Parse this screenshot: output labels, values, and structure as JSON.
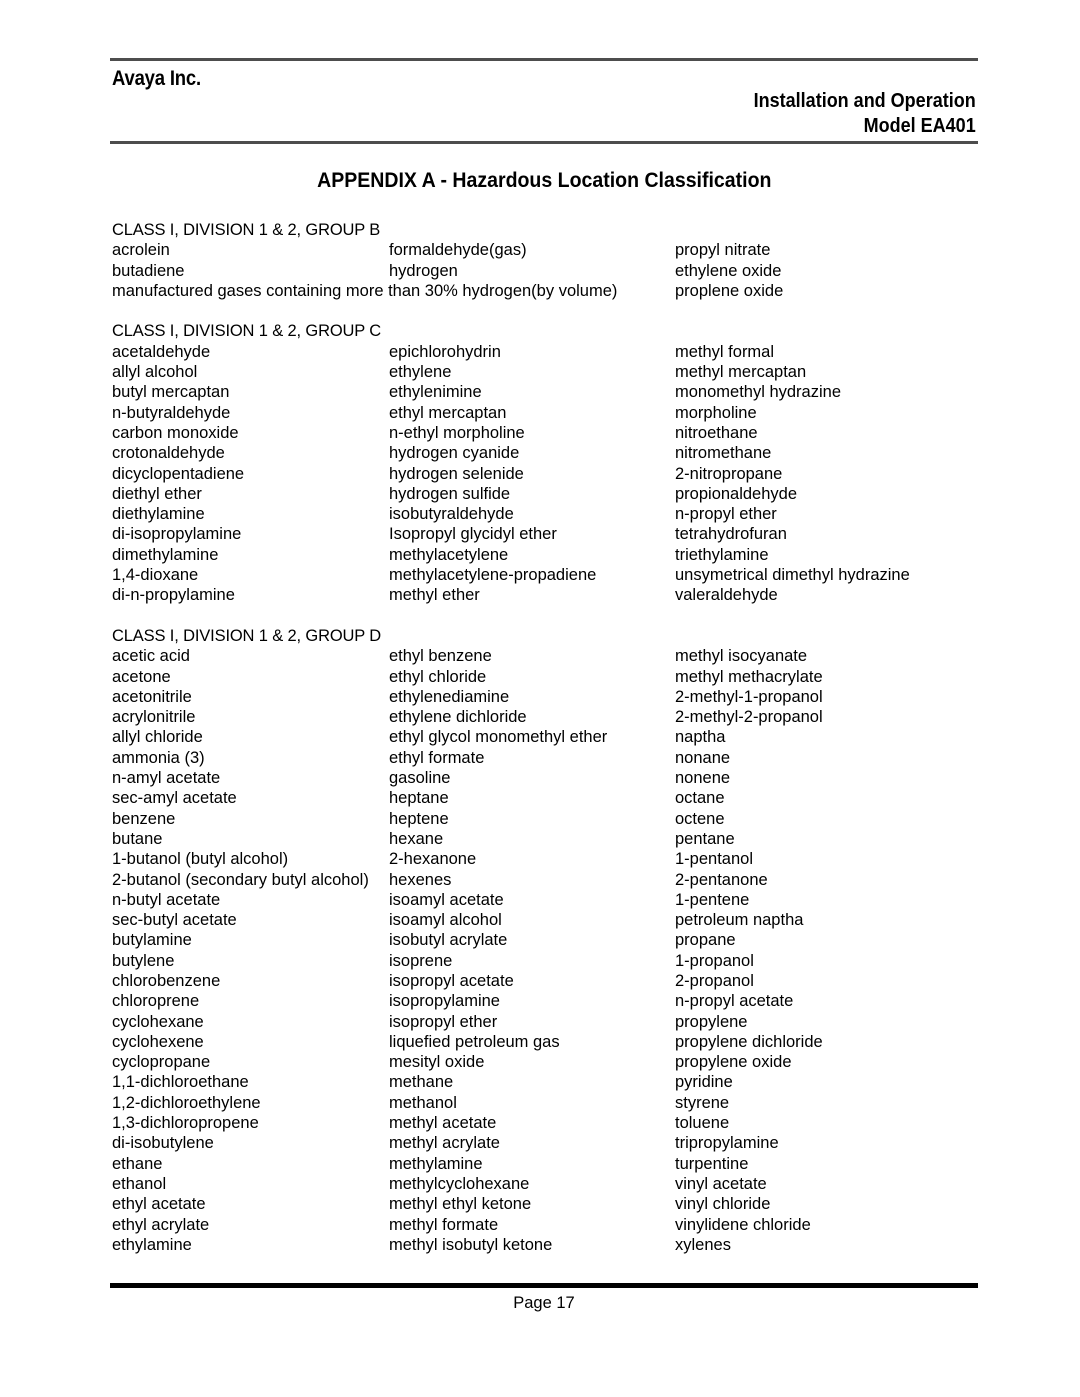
{
  "header": {
    "company": "Avaya Inc.",
    "doc_line1": "Installation and Operation",
    "doc_line2": "Model EA401"
  },
  "title": "APPENDIX A - Hazardous Location Classification",
  "footer": {
    "page_label": "Page 17"
  },
  "groups": [
    {
      "heading": "CLASS I, DIVISION 1 & 2, GROUP B",
      "rows": [
        {
          "c1": "acrolein",
          "c2": "formaldehyde(gas)",
          "c3": "propyl nitrate"
        },
        {
          "c1": "butadiene",
          "c2": "hydrogen",
          "c3": "ethylene oxide"
        },
        {
          "c1": "manufactured gases containing more than 30% hydrogen(by volume)",
          "c2": "",
          "c3": "proplene oxide"
        }
      ]
    },
    {
      "heading": "CLASS I, DIVISION 1 & 2, GROUP C",
      "rows": [
        {
          "c1": "acetaldehyde",
          "c2": "epichlorohydrin",
          "c3": "methyl formal"
        },
        {
          "c1": "allyl alcohol",
          "c2": "ethylene",
          "c3": "methyl mercaptan"
        },
        {
          "c1": "butyl mercaptan",
          "c2": "ethylenimine",
          "c3": "monomethyl hydrazine"
        },
        {
          "c1": "n-butyraldehyde",
          "c2": "ethyl mercaptan",
          "c3": "morpholine"
        },
        {
          "c1": "carbon monoxide",
          "c2": "n-ethyl morpholine",
          "c3": "nitroethane"
        },
        {
          "c1": "crotonaldehyde",
          "c2": "hydrogen cyanide",
          "c3": "nitromethane"
        },
        {
          "c1": "dicyclopentadiene",
          "c2": "hydrogen selenide",
          "c3": "2-nitropropane"
        },
        {
          "c1": "diethyl ether",
          "c2": "hydrogen sulfide",
          "c3": "propionaldehyde"
        },
        {
          "c1": "diethylamine",
          "c2": "isobutyraldehyde",
          "c3": "n-propyl ether"
        },
        {
          "c1": "di-isopropylamine",
          "c2": "Isopropyl glycidyl ether",
          "c3": "tetrahydrofuran"
        },
        {
          "c1": "dimethylamine",
          "c2": "methylacetylene",
          "c3": "triethylamine"
        },
        {
          "c1": "1,4-dioxane",
          "c2": "methylacetylene-propadiene",
          "c3": "unsymetrical dimethyl hydrazine"
        },
        {
          "c1": "di-n-propylamine",
          "c2": "methyl ether",
          "c3": "valeraldehyde"
        }
      ]
    },
    {
      "heading": "CLASS I, DIVISION 1 & 2, GROUP D",
      "rows": [
        {
          "c1": "acetic acid",
          "c2": "ethyl benzene",
          "c3": "methyl isocyanate"
        },
        {
          "c1": "acetone",
          "c2": "ethyl chloride",
          "c3": "methyl methacrylate"
        },
        {
          "c1": "acetonitrile",
          "c2": "ethylenediamine",
          "c3": "2-methyl-1-propanol"
        },
        {
          "c1": "acrylonitrile",
          "c2": "ethylene dichloride",
          "c3": "2-methyl-2-propanol"
        },
        {
          "c1": "allyl chloride",
          "c2": "ethyl glycol monomethyl ether",
          "c3": "naptha"
        },
        {
          "c1": "ammonia (3)",
          "c2": "ethyl formate",
          "c3": "nonane"
        },
        {
          "c1": "n-amyl acetate",
          "c2": "gasoline",
          "c3": "nonene"
        },
        {
          "c1": "sec-amyl acetate",
          "c2": "heptane",
          "c3": "octane"
        },
        {
          "c1": "benzene",
          "c2": "heptene",
          "c3": "octene"
        },
        {
          "c1": "butane",
          "c2": "hexane",
          "c3": "pentane"
        },
        {
          "c1": "1-butanol (butyl alcohol)",
          "c2": "2-hexanone",
          "c3": "1-pentanol"
        },
        {
          "c1": "2-butanol (secondary butyl alcohol)",
          "c2": "hexenes",
          "c3": "2-pentanone"
        },
        {
          "c1": "n-butyl acetate",
          "c2": "isoamyl acetate",
          "c3": "1-pentene"
        },
        {
          "c1": "sec-butyl acetate",
          "c2": "isoamyl alcohol",
          "c3": "petroleum naptha"
        },
        {
          "c1": "butylamine",
          "c2": "isobutyl acrylate",
          "c3": "propane"
        },
        {
          "c1": "butylene",
          "c2": "isoprene",
          "c3": "1-propanol"
        },
        {
          "c1": "chlorobenzene",
          "c2": "isopropyl acetate",
          "c3": "2-propanol"
        },
        {
          "c1": "chloroprene",
          "c2": "isopropylamine",
          "c3": "n-propyl acetate"
        },
        {
          "c1": "cyclohexane",
          "c2": "isopropyl ether",
          "c3": "propylene"
        },
        {
          "c1": "cyclohexene",
          "c2": "liquefied petroleum gas",
          "c3": "propylene dichloride"
        },
        {
          "c1": "cyclopropane",
          "c2": "mesityl oxide",
          "c3": "propylene oxide"
        },
        {
          "c1": "1,1-dichloroethane",
          "c2": "methane",
          "c3": "pyridine"
        },
        {
          "c1": "1,2-dichloroethylene",
          "c2": "methanol",
          "c3": "styrene"
        },
        {
          "c1": "1,3-dichloropropene",
          "c2": "methyl acetate",
          "c3": "toluene"
        },
        {
          "c1": "di-isobutylene",
          "c2": "methyl acrylate",
          "c3": "tripropylamine"
        },
        {
          "c1": "ethane",
          "c2": "methylamine",
          "c3": "turpentine"
        },
        {
          "c1": "ethanol",
          "c2": "methylcyclohexane",
          "c3": "vinyl acetate"
        },
        {
          "c1": "ethyl acetate",
          "c2": "methyl ethyl ketone",
          "c3": "vinyl chloride"
        },
        {
          "c1": "ethyl acrylate",
          "c2": "methyl formate",
          "c3": "vinylidene chloride"
        },
        {
          "c1": "ethylamine",
          "c2": "methyl isobutyl ketone",
          "c3": "xylenes"
        }
      ]
    }
  ]
}
